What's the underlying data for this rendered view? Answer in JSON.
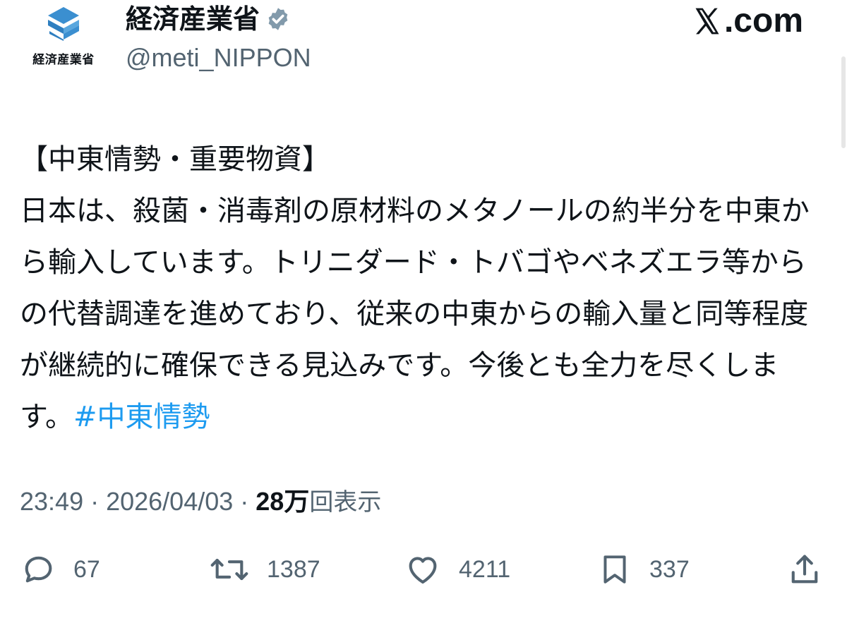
{
  "account": {
    "avatar_label": "経済産業省",
    "display_name": "経済産業省",
    "handle": "@meti_NIPPON",
    "verified": true
  },
  "site": {
    "logo_text": ".com"
  },
  "tweet": {
    "text": "【中東情勢・重要物資】\n日本は、殺菌・消毒剤の原材料のメタノールの約半分を中東から輸入しています。トリニダード・トバゴやベネズエラ等からの代替調達を進めており、従来の中東からの輸入量と同等程度が継続的に確保できる見込みです。今後とも全力を尽くします。",
    "hashtag": "#中東情勢"
  },
  "meta": {
    "time": "23:49",
    "separator_1": " · ",
    "date": "2026/04/03",
    "separator_2": " · ",
    "views_count": "28万",
    "views_label": "回表示"
  },
  "actions": {
    "replies": "67",
    "reposts": "1387",
    "likes": "4211",
    "bookmarks": "337"
  },
  "colors": {
    "text": "#0f1419",
    "secondary": "#536471",
    "link": "#1d9bf0",
    "brand_blue": "#3b8fd0"
  },
  "icons": {
    "reply": "speech-bubble-icon",
    "repost": "repost-arrows-icon",
    "like": "heart-icon",
    "bookmark": "bookmark-icon",
    "share": "share-upload-icon",
    "verified": "verified-badge-icon",
    "logo": "x-logo-icon",
    "avatar": "meti-logo-icon"
  }
}
